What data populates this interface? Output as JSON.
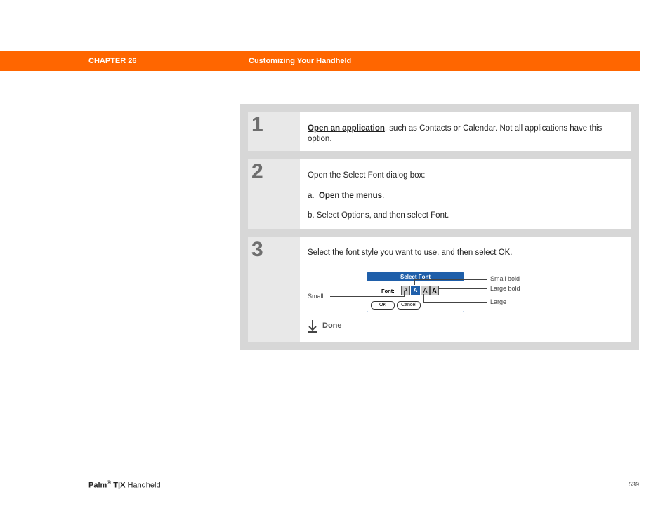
{
  "header": {
    "chapter": "CHAPTER 26",
    "title": "Customizing Your Handheld",
    "color": "#ff6600"
  },
  "steps": [
    {
      "number": "1",
      "link": "Open an application",
      "text": ", such as Contacts or Calendar. Not all applications have this option."
    },
    {
      "number": "2",
      "intro": "Open the Select Font dialog box:",
      "a_prefix": "a.",
      "a_link": "Open the menus",
      "a_suffix": ".",
      "b_text": "b.  Select Options, and then select Font."
    },
    {
      "number": "3",
      "text": "Select the font style you want to use, and then select OK."
    }
  ],
  "dialog": {
    "title": "Select Font",
    "font_label": "Font:",
    "font_buttons": [
      "A",
      "A",
      "A",
      "A"
    ],
    "ok_label": "OK",
    "cancel_label": "Cancel"
  },
  "callouts": {
    "small": "Small",
    "small_bold": "Small bold",
    "large_bold": "Large bold",
    "large": "Large"
  },
  "done": {
    "label": "Done",
    "icon": "down-arrow-icon"
  },
  "footer": {
    "brand": "Palm",
    "reg": "®",
    "model": "T|X",
    "product_suffix": "Handheld",
    "page": "539"
  }
}
